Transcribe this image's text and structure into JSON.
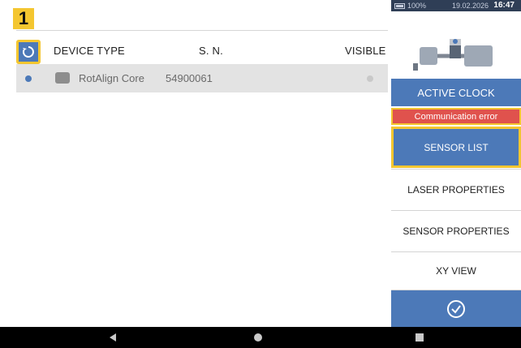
{
  "badge": "1",
  "table": {
    "headers": [
      "DEVICE TYPE",
      "S. N.",
      "VISIBLE"
    ],
    "rows": [
      {
        "device": "RotAlign Core",
        "sn": "54900061"
      }
    ]
  },
  "status_bar": {
    "battery": "100%",
    "date": "19.02.2026",
    "time": "16:47"
  },
  "menu": {
    "active_clock": "ACTIVE CLOCK",
    "comm_error": "Communication error",
    "sensor_list": "SENSOR LIST",
    "laser_properties": "LASER PROPERTIES",
    "sensor_properties": "SENSOR PROPERTIES",
    "xy_view": "XY VIEW"
  },
  "colors": {
    "accent_blue": "#4c79b8",
    "highlight_yellow": "#f4c630",
    "error_red": "#e0524d"
  },
  "icons": [
    "refresh-icon",
    "battery-icon",
    "machine-icon",
    "check-circle-icon",
    "back-icon",
    "home-icon",
    "recent-apps-icon"
  ]
}
